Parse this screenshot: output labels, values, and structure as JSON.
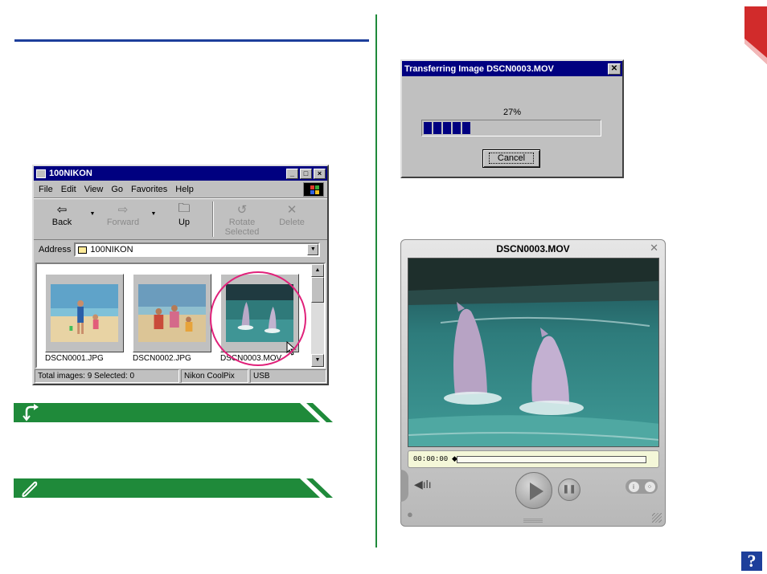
{
  "explorer": {
    "title": "100NIKON",
    "menu": [
      "File",
      "Edit",
      "View",
      "Go",
      "Favorites",
      "Help"
    ],
    "toolbar": {
      "back": "Back",
      "forward": "Forward",
      "up": "Up",
      "rotate_line1": "Rotate",
      "rotate_line2": "Selected",
      "delete": "Delete"
    },
    "address_label": "Address",
    "address_value": "100NIKON",
    "files": [
      "DSCN0001.JPG",
      "DSCN0002.JPG",
      "DSCN0003.MOV"
    ],
    "status": {
      "totals": "Total images: 9   Selected: 0",
      "device": "Nikon CoolPix",
      "connection": "USB"
    }
  },
  "dialog": {
    "title": "Transferring Image DSCN0003.MOV",
    "percent_text": "27%",
    "progress": 0.27,
    "cancel_label": "Cancel"
  },
  "player": {
    "title": "DSCN0003.MOV",
    "timecode": "00:00:00"
  },
  "colors": {
    "title_rule": "#1d3f9b",
    "banner_green": "#1f8a3a",
    "win_titlebar": "#000080",
    "highlight_ring": "#e0217a",
    "corner_tab": "#d12b2b"
  },
  "icons": {
    "banner_top": "caution-arrow-icon",
    "banner_bottom": "pencil-note-icon",
    "help": "question-mark-icon"
  },
  "help_glyph": "?"
}
